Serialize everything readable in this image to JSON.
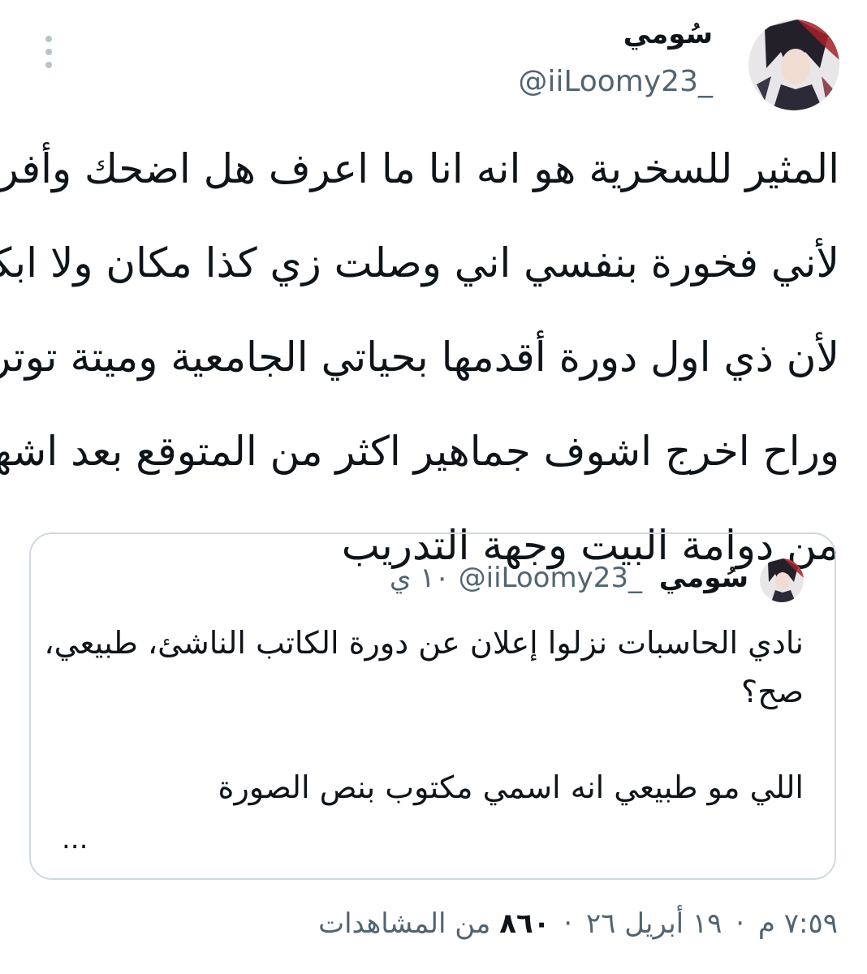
{
  "author": {
    "display_name": "سُومي",
    "handle": "@iiLoomy23_"
  },
  "tweet": {
    "lines": [
      "المثير للسخرية هو انه انا ما اعرف هل اضحك وأفرح",
      "لأني فخورة بنفسي اني وصلت زي كذا مكان ولا ابكي",
      "لأن ذي اول دورة أقدمها بحياتي الجامعية وميتة توتر",
      "وراح اخرج اشوف جماهير اكثر من المتوقع بعد اشهر",
      "من دوامة البيت وجهة التدريب"
    ]
  },
  "quote": {
    "display_name": "سُومي",
    "handle": "@iiLoomy23_",
    "dot": "·",
    "time": "١٠ ي",
    "lines": [
      "نادي الحاسبات نزلوا إعلان عن دورة الكاتب الناشئ، طبيعي،",
      "صح؟",
      "",
      "اللي مو طبيعي انه اسمي مكتوب بنص الصورة"
    ],
    "ellipsis": "..."
  },
  "meta": {
    "time": "٧:٥٩ م",
    "date": "١٩ أبريل ٢٦",
    "views_count": "٨٦٠",
    "views_label": "من المشاهدات",
    "separator": "·"
  },
  "icons": {
    "more": "more-vertical-icon"
  }
}
